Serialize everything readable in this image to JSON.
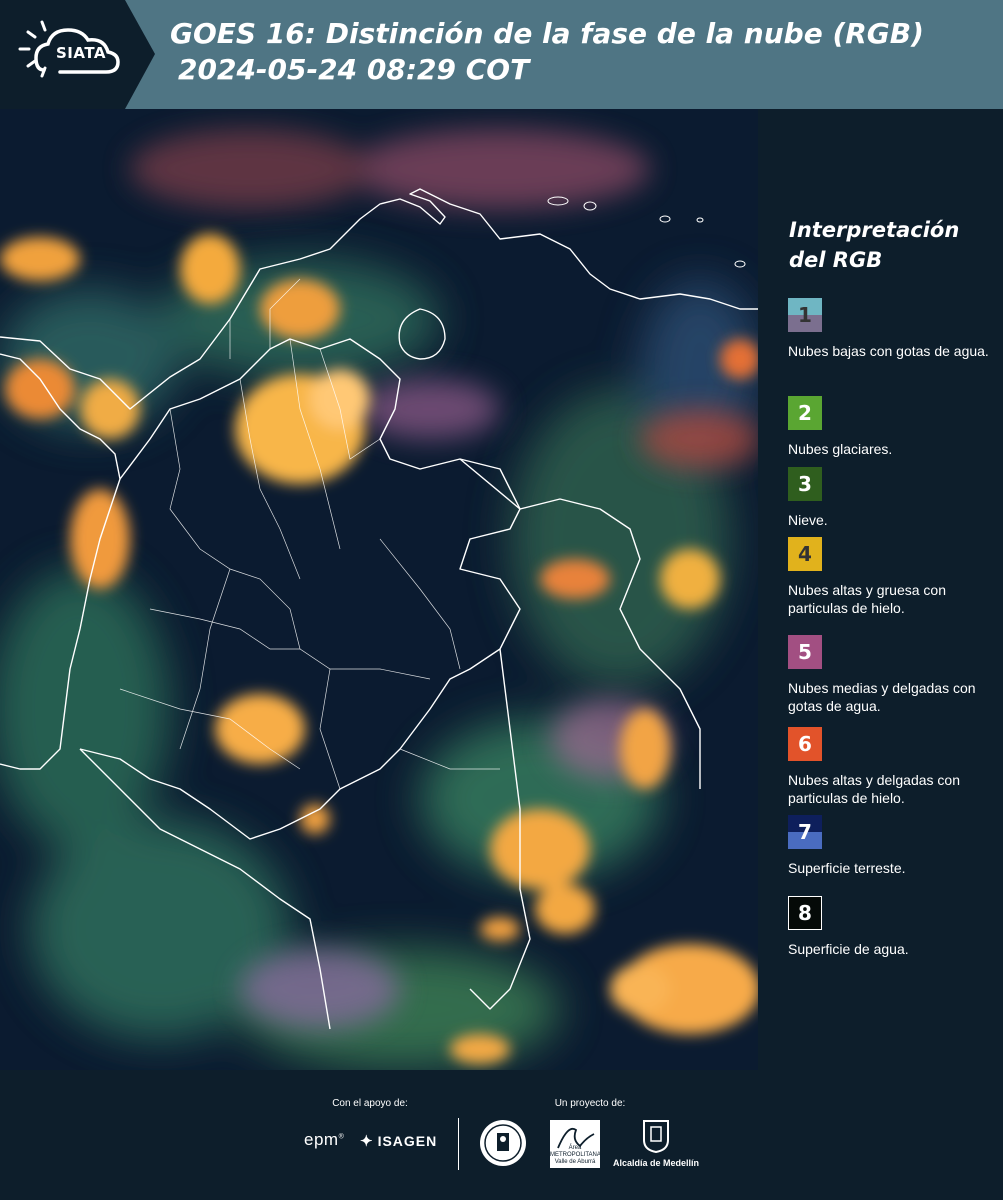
{
  "header": {
    "logo_text": "SIATA",
    "title_line1": "GOES 16: Distinción de la fase de la nube (RGB)",
    "title_line2": "2024-05-24 08:29 COT"
  },
  "legend": {
    "title": "Interpretación del RGB",
    "items": [
      {
        "number": "1",
        "label": "Nubes bajas con gotas de agua.",
        "color_top": "#6fb6c3",
        "color_bottom": "#7b6f8f",
        "num_color": "#333333"
      },
      {
        "number": "2",
        "label": "Nubes glaciares.",
        "color_top": "#5aa632",
        "color_bottom": "#5aa632",
        "num_color": "#ffffff"
      },
      {
        "number": "3",
        "label": "Nieve.",
        "color_top": "#2f5e1e",
        "color_bottom": "#2f5e1e",
        "num_color": "#ffffff"
      },
      {
        "number": "4",
        "label": "Nubes altas y gruesa con particulas de hielo.",
        "color_top": "#e1b21c",
        "color_bottom": "#e1b21c",
        "num_color": "#333333"
      },
      {
        "number": "5",
        "label": "Nubes medias y delgadas con gotas de agua.",
        "color_top": "#a24f82",
        "color_bottom": "#a24f82",
        "num_color": "#ffffff"
      },
      {
        "number": "6",
        "label": "Nubes altas y delgadas con particulas de hielo.",
        "color_top": "#e2532a",
        "color_bottom": "#e2532a",
        "num_color": "#ffffff"
      },
      {
        "number": "7",
        "label": "Superficie terreste.",
        "color_top": "#0e1f5c",
        "color_bottom": "#4a6cc0",
        "num_color": "#ffffff"
      },
      {
        "number": "8",
        "label": "Superficie de agua.",
        "color_top": "#050a08",
        "color_bottom": "#050a08",
        "num_color": "#ffffff"
      }
    ]
  },
  "footer": {
    "support_label": "Con el apoyo de:",
    "project_label": "Un proyecto de:",
    "epm": "epm",
    "isagen": "ISAGEN",
    "area_logo_text": "Área METROPOLITANA Valle de Aburrá",
    "alcaldia": "Alcaldía de Medellín"
  },
  "colors": {
    "header_bg": "#4f7584",
    "panel_bg": "#0d1e2b"
  }
}
